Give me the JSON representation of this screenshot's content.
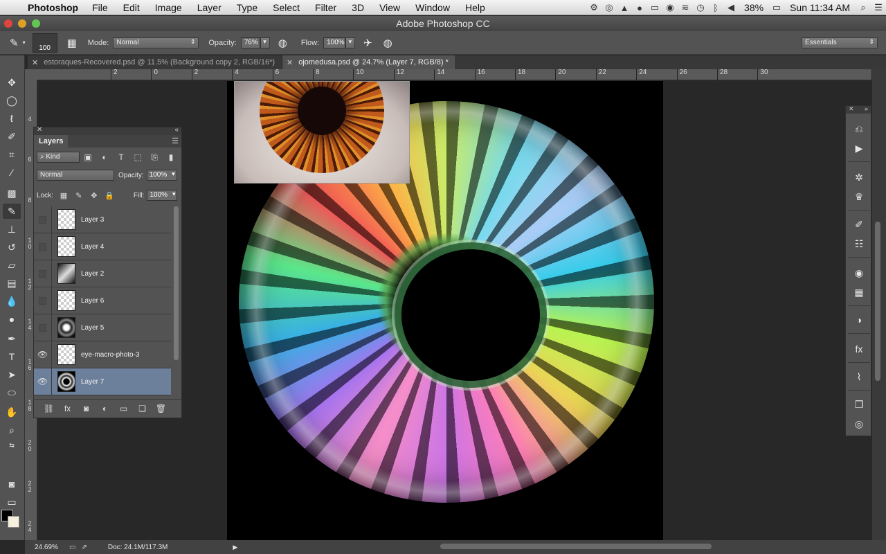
{
  "menubar": {
    "app_name": "Photoshop",
    "items": [
      "File",
      "Edit",
      "Image",
      "Layer",
      "Type",
      "Select",
      "Filter",
      "3D",
      "View",
      "Window",
      "Help"
    ],
    "battery": "38%",
    "clock": "Sun 11:34 AM"
  },
  "window": {
    "title": "Adobe Photoshop CC"
  },
  "options": {
    "brush_size": "100",
    "mode_label": "Mode:",
    "mode_value": "Normal",
    "opacity_label": "Opacity:",
    "opacity_value": "76%",
    "flow_label": "Flow:",
    "flow_value": "100%",
    "workspace": "Essentials"
  },
  "tabs": [
    {
      "label": "estoraques-Recovered.psd @ 11.5% (Background copy 2, RGB/16*)"
    },
    {
      "label": "ojomedusa.psd @ 24.7% (Layer 7, RGB/8) *"
    }
  ],
  "ruler": {
    "h_ticks": [
      "2",
      "0",
      "2",
      "4",
      "6",
      "8",
      "10",
      "12",
      "14",
      "16",
      "18",
      "20",
      "22",
      "24",
      "26",
      "28",
      "30"
    ],
    "v_ticks": [
      "4",
      "6",
      "8",
      "1\n0",
      "1\n2",
      "1\n4",
      "1\n6",
      "1\n8",
      "2\n0",
      "2\n2",
      "2\n4"
    ]
  },
  "layers_panel": {
    "title": "Layers",
    "filter_kind": "Kind",
    "blend_mode": "Normal",
    "opacity_label": "Opacity:",
    "opacity_value": "100%",
    "lock_label": "Lock:",
    "fill_label": "Fill:",
    "fill_value": "100%",
    "layers": [
      {
        "name": "Layer 3",
        "visible": false,
        "selected": false
      },
      {
        "name": "Layer 4",
        "visible": false,
        "selected": false
      },
      {
        "name": "Layer 2",
        "visible": false,
        "selected": false
      },
      {
        "name": "Layer 6",
        "visible": false,
        "selected": false
      },
      {
        "name": "Layer 5",
        "visible": false,
        "selected": false
      },
      {
        "name": "eye-macro-photo-3",
        "visible": true,
        "selected": false
      },
      {
        "name": "Layer 7",
        "visible": true,
        "selected": true
      }
    ]
  },
  "status": {
    "zoom": "24.69%",
    "doc": "Doc: 24.1M/117.3M"
  }
}
